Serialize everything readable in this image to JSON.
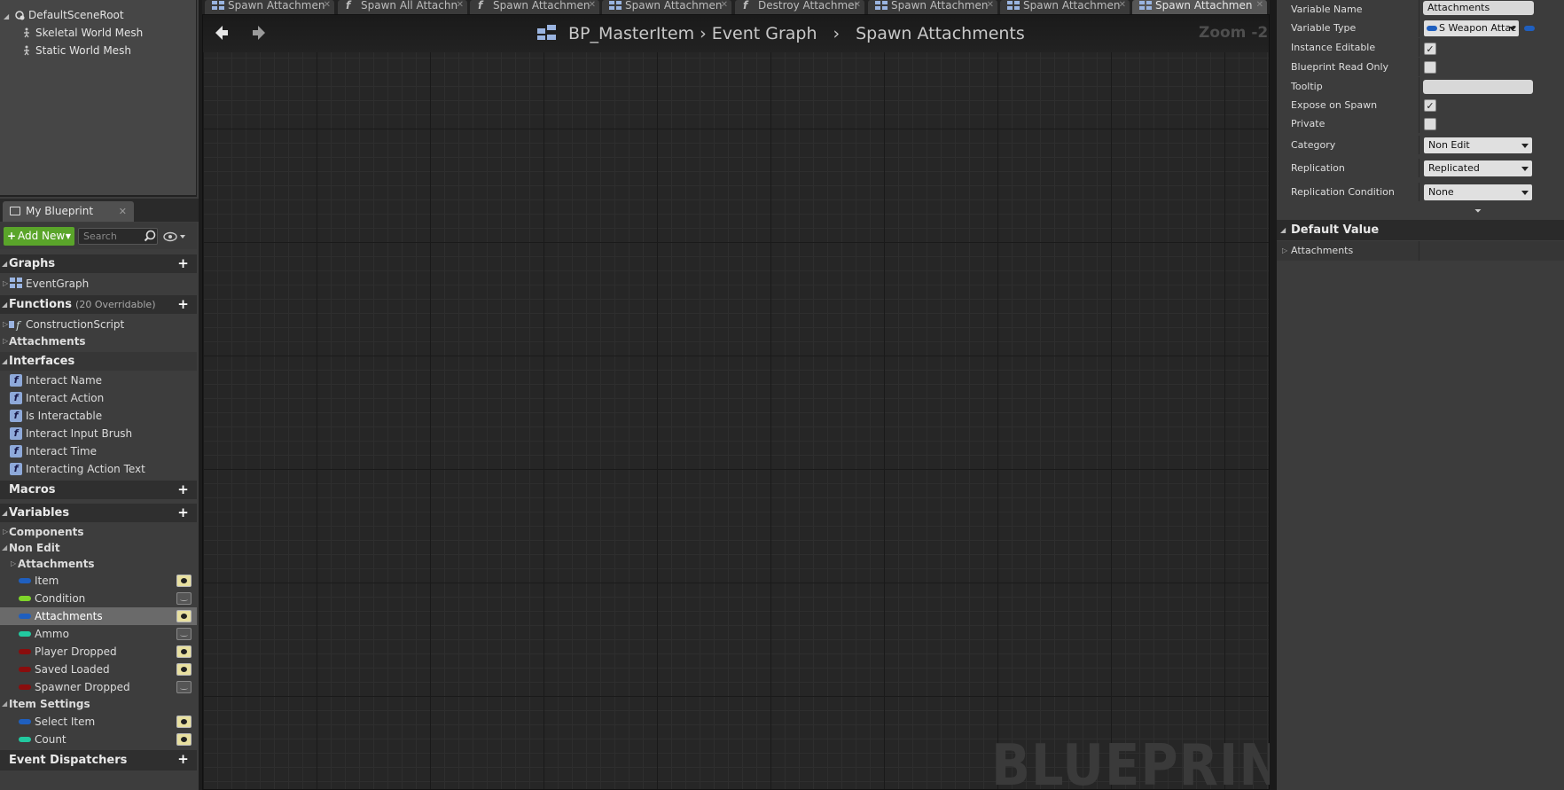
{
  "components": {
    "root": "DefaultSceneRoot",
    "children": [
      "Skeletal World Mesh",
      "Static World Mesh"
    ]
  },
  "my_blueprint": {
    "tab_label": "My Blueprint",
    "add_new_label": "Add New",
    "search_placeholder": "Search"
  },
  "sections": {
    "graphs": "Graphs",
    "functions": "Functions",
    "functions_sub": "(20 Overridable)",
    "interfaces": "Interfaces",
    "macros": "Macros",
    "variables": "Variables",
    "event_dispatchers": "Event Dispatchers"
  },
  "graphs": [
    "EventGraph"
  ],
  "functions": [
    "ConstructionScript"
  ],
  "function_categories": [
    "Attachments"
  ],
  "interfaces": [
    "Interact Name",
    "Interact Action",
    "Is Interactable",
    "Interact Input Brush",
    "Interact Time",
    "Interacting Action Text"
  ],
  "variables": {
    "categories": {
      "components": "Components",
      "non_edit": "Non Edit",
      "attachments": "Attachments",
      "item_settings": "Item Settings"
    },
    "non_edit": [
      {
        "name": "Item",
        "color": "#1f5fbf",
        "visible": true
      },
      {
        "name": "Condition",
        "color": "#7fd42a",
        "visible": false
      },
      {
        "name": "Attachments",
        "color": "#1f5fbf",
        "visible": true
      },
      {
        "name": "Ammo",
        "color": "#22c9a0",
        "visible": false
      },
      {
        "name": "Player Dropped",
        "color": "#8a0d0d",
        "visible": true
      },
      {
        "name": "Saved Loaded",
        "color": "#8a0d0d",
        "visible": true
      },
      {
        "name": "Spawner Dropped",
        "color": "#8a0d0d",
        "visible": false
      }
    ],
    "item_settings": [
      {
        "name": "Select Item",
        "color": "#1f5fbf",
        "visible": true
      },
      {
        "name": "Count",
        "color": "#22c9a0",
        "visible": true
      }
    ]
  },
  "tabs": [
    {
      "label": "Spawn Attachmen",
      "icon": "graph-icon"
    },
    {
      "label": "Spawn All Attachn",
      "icon": "function-icon"
    },
    {
      "label": "Spawn Attachmen",
      "icon": "function-icon"
    },
    {
      "label": "Spawn Attachmen",
      "icon": "graph-icon"
    },
    {
      "label": "Destroy Attachmer",
      "icon": "function-icon"
    },
    {
      "label": "Spawn Attachmen",
      "icon": "graph-icon"
    },
    {
      "label": "Spawn Attachmen",
      "icon": "graph-icon"
    },
    {
      "label": "Spawn Attachmen",
      "icon": "graph-icon"
    }
  ],
  "graph": {
    "breadcrumb": [
      "BP_MasterItem",
      "Event Graph",
      "Spawn Attachments"
    ],
    "zoom": "Zoom -2",
    "watermark": "BLUEPRINT"
  },
  "details": {
    "variable_name_label": "Variable Name",
    "variable_name": "Attachments",
    "variable_type_label": "Variable Type",
    "variable_type": "S Weapon Attac",
    "instance_editable_label": "Instance Editable",
    "instance_editable": true,
    "blueprint_read_only_label": "Blueprint Read Only",
    "blueprint_read_only": false,
    "tooltip_label": "Tooltip",
    "tooltip": "",
    "expose_on_spawn_label": "Expose on Spawn",
    "expose_on_spawn": true,
    "private_label": "Private",
    "private": false,
    "category_label": "Category",
    "category": "Non Edit",
    "replication_label": "Replication",
    "replication": "Replicated",
    "replication_condition_label": "Replication Condition",
    "replication_condition": "None",
    "default_value_label": "Default Value",
    "default_value_row": "Attachments"
  },
  "colors": {
    "add_new": "#5aa52a",
    "struct_pin": "#1f5fbf",
    "bool_pin": "#8a0d0d",
    "int_pin": "#22c9a0",
    "float_pin": "#7fd42a"
  }
}
